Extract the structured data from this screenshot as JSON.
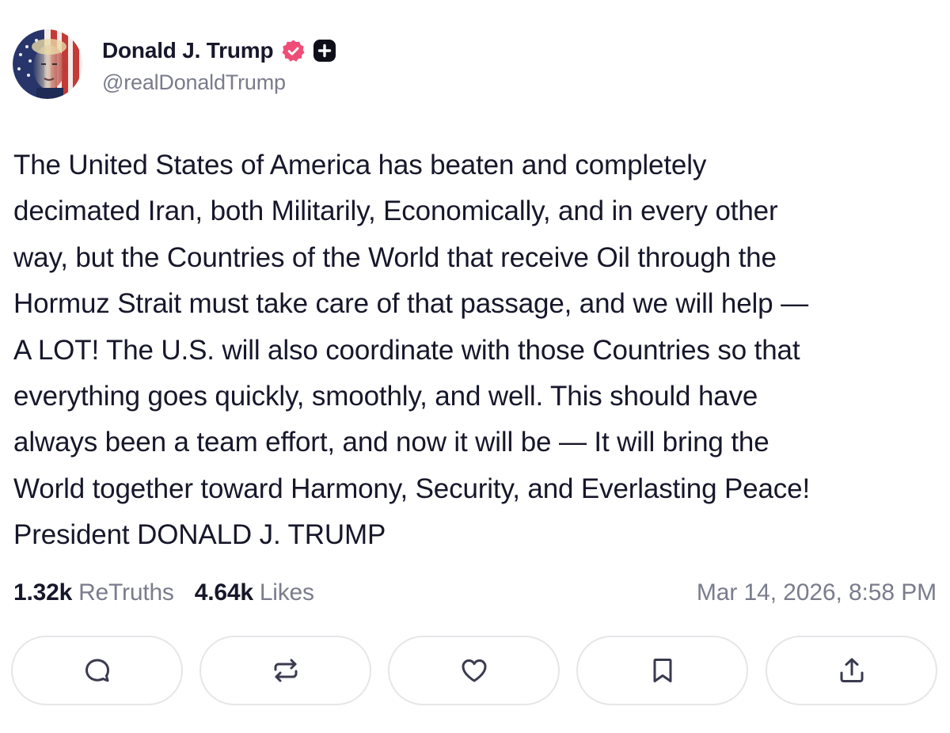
{
  "author": {
    "display_name": "Donald J. Trump",
    "handle": "@realDonaldTrump"
  },
  "post": {
    "lines": [
      "The United States of America has beaten and completely",
      "decimated Iran, both Militarily, Economically, and in every other",
      "way, but the Countries of the World that receive Oil through the",
      "Hormuz Strait must take care of that passage, and we will help —",
      "A LOT! The U.S. will also coordinate with those Countries so that",
      "everything goes quickly, smoothly, and well. This should have",
      "always been a team effort, and now it will be — It will bring the",
      "World together toward Harmony, Security, and Everlasting Peace!",
      "President DONALD J. TRUMP"
    ]
  },
  "stats": {
    "retruths_count": "1.32k",
    "retruths_label": "ReTruths",
    "likes_count": "4.64k",
    "likes_label": "Likes",
    "timestamp": "Mar 14, 2026, 8:58 PM"
  },
  "actions": [
    {
      "icon": "reply-icon"
    },
    {
      "icon": "retruth-icon"
    },
    {
      "icon": "like-icon"
    },
    {
      "icon": "bookmark-icon"
    },
    {
      "icon": "share-icon"
    }
  ],
  "colors": {
    "text": "#17172b",
    "muted": "#7a7c8c",
    "verified_badge": "#ef4d77",
    "action_border": "#e6e6ea",
    "icon_stroke": "#3a3b4f"
  }
}
